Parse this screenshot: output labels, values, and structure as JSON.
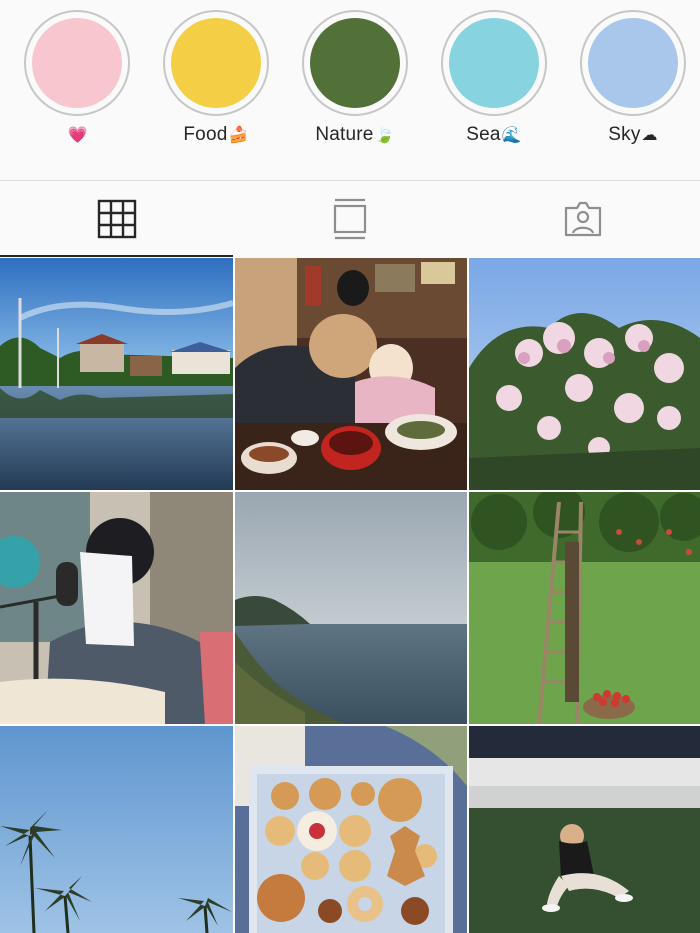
{
  "highlights": [
    {
      "label": "",
      "emoji": "💗",
      "color": "#f7c6cf"
    },
    {
      "label": "Food",
      "emoji": "🍰",
      "color": "#f4cf45"
    },
    {
      "label": "Nature",
      "emoji": "🍃",
      "color": "#527138"
    },
    {
      "label": "Sea",
      "emoji": "🌊",
      "color": "#88d3e0"
    },
    {
      "label": "Sky",
      "emoji": "☁",
      "color": "#a8c7ea"
    }
  ],
  "tabs": [
    {
      "name": "grid",
      "icon": "grid-icon",
      "active": true
    },
    {
      "name": "feed",
      "icon": "feed-list-icon",
      "active": false
    },
    {
      "name": "tagged",
      "icon": "tagged-person-icon",
      "active": false
    }
  ],
  "posts": [
    {
      "subject": "lake-village-reflection"
    },
    {
      "subject": "restaurant-people-bowls"
    },
    {
      "subject": "flowering-tree-blue-sky"
    },
    {
      "subject": "radio-studio-microphone"
    },
    {
      "subject": "sea-headland"
    },
    {
      "subject": "orchard-ladder-apples"
    },
    {
      "subject": "palm-trees-sky"
    },
    {
      "subject": "cookie-box"
    },
    {
      "subject": "person-sitting-grass"
    }
  ],
  "colors": {
    "text": "#262626",
    "border": "#dbdbdb",
    "ring": "#c7c7c7",
    "background": "#fafafa"
  }
}
